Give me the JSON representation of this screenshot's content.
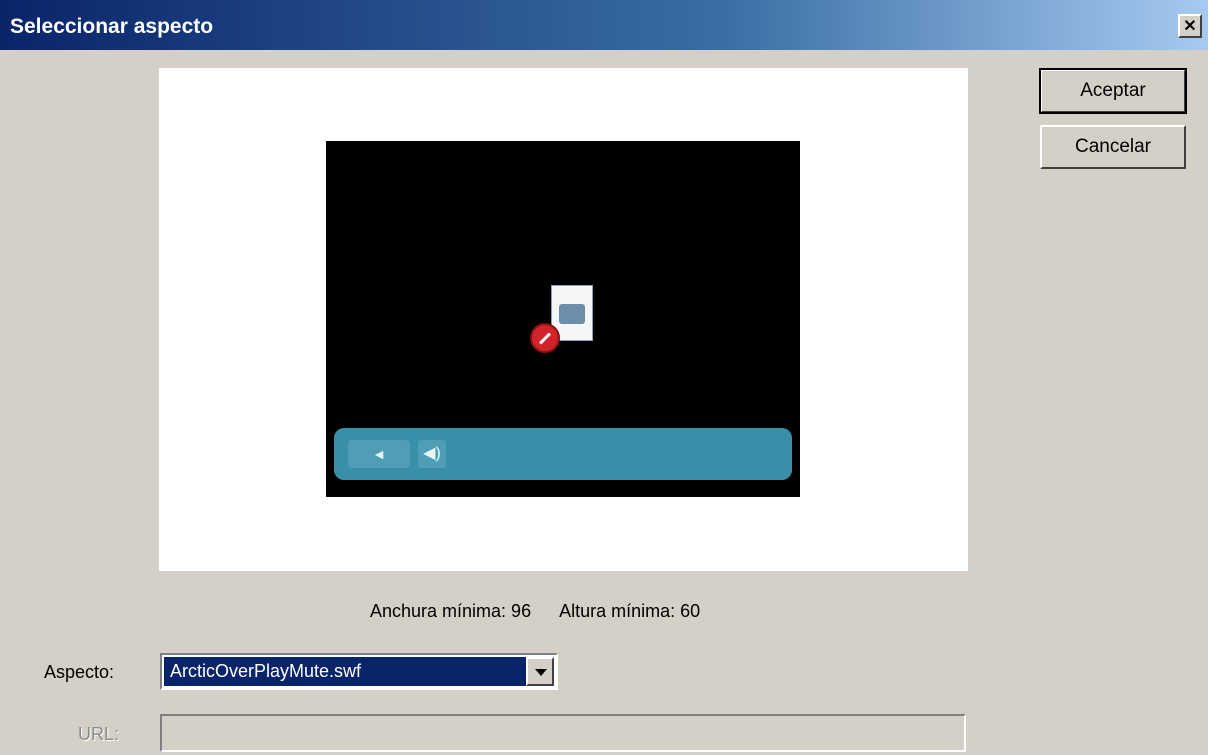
{
  "window": {
    "title": "Seleccionar aspecto",
    "close_symbol": "✕"
  },
  "buttons": {
    "ok_label": "Aceptar",
    "cancel_label": "Cancelar"
  },
  "preview": {
    "play_symbol": "◄",
    "volume_symbol": "◀)"
  },
  "dimensions": {
    "min_width_label": "Anchura mínima: 96",
    "min_height_label": "Altura mínima: 60"
  },
  "skin": {
    "label": "Aspecto:",
    "selected_value": "ArcticOverPlayMute.swf"
  },
  "url": {
    "label": "URL:",
    "value": ""
  },
  "colors": {
    "title_gradient_start": "#0a246a",
    "controlbar": "#3a8fa8",
    "selection": "#0a246a"
  }
}
